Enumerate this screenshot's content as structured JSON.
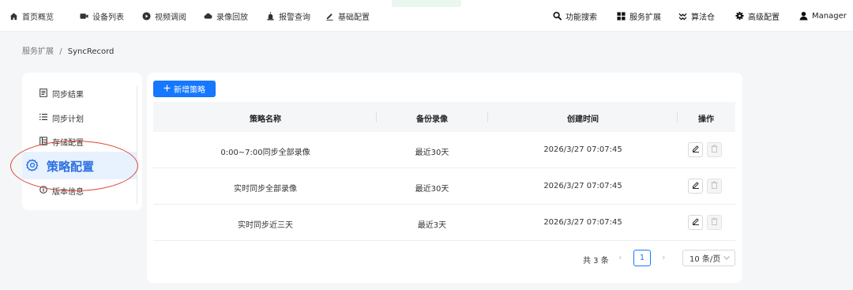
{
  "nav": {
    "left": [
      {
        "key": "home",
        "icon": "home-icon",
        "label": "首页概览"
      },
      {
        "key": "devices",
        "icon": "camera-icon",
        "label": "设备列表"
      },
      {
        "key": "video",
        "icon": "play-circle-icon",
        "label": "视频调阅"
      },
      {
        "key": "playback",
        "icon": "cloud-icon",
        "label": "录像回放"
      },
      {
        "key": "alarm",
        "icon": "alarm-icon",
        "label": "报警查询"
      },
      {
        "key": "config",
        "icon": "edit-icon",
        "label": "基础配置"
      }
    ],
    "right": [
      {
        "key": "search",
        "icon": "search-icon",
        "label": "功能搜索"
      },
      {
        "key": "services",
        "icon": "grid-icon",
        "label": "服务扩展"
      },
      {
        "key": "algorithms",
        "icon": "algorithm-icon",
        "label": "算法仓"
      },
      {
        "key": "advanced",
        "icon": "gear-icon",
        "label": "高级配置"
      },
      {
        "key": "user",
        "icon": "user-icon",
        "label": "Manager"
      }
    ]
  },
  "breadcrumb": {
    "parent": "服务扩展",
    "separator": "/",
    "current": "SyncRecord"
  },
  "sidebar": {
    "items": [
      {
        "icon": "list-icon",
        "label": "同步结果"
      },
      {
        "icon": "list-lines-icon",
        "label": "同步计划"
      },
      {
        "icon": "storage-icon",
        "label": "存储配置"
      },
      {
        "icon": "gear-icon",
        "label": "策略配置",
        "active": true
      },
      {
        "icon": "info-icon",
        "label": "版本信息"
      }
    ]
  },
  "toolbar": {
    "add_label": "新增策略"
  },
  "table": {
    "columns": [
      "策略名称",
      "备份录像",
      "创建时间",
      "操作"
    ],
    "rows": [
      {
        "name": "0:00~7:00同步全部录像",
        "backup": "最近30天",
        "created": "2026/3/27 07:07:45"
      },
      {
        "name": "实时同步全部录像",
        "backup": "最近30天",
        "created": "2026/3/27 07:07:45"
      },
      {
        "name": "实时同步近三天",
        "backup": "最近3天",
        "created": "2026/3/27 07:07:45"
      }
    ]
  },
  "pagination": {
    "total_label": "共 3 条",
    "current_page": "1",
    "page_size": "10 条/页"
  },
  "colors": {
    "accent": "#1677ff",
    "annotation": "#d9483a",
    "active_bg": "#e8f2ff"
  }
}
